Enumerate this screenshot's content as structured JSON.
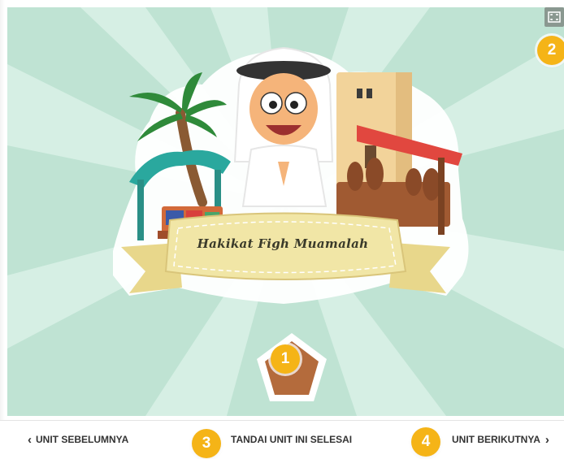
{
  "banner": {
    "title": "Hakikat Figh Muamalah"
  },
  "stage": {
    "background_color": "#bfe3d3",
    "start_button": {
      "icon": "pentagon-start-icon",
      "color": "#b46b3c"
    }
  },
  "badges": [
    "1",
    "2",
    "3",
    "4"
  ],
  "toolbar": {
    "fullscreen_icon": "fullscreen-icon"
  },
  "footer": {
    "prev_label": "UNIT SEBELUMNYA",
    "mark_complete_label": "TANDAI UNIT INI SELESAI",
    "next_label": "UNIT BERIKUTNYA",
    "prev_icon": "chevron-left-icon",
    "next_icon": "chevron-right-icon"
  },
  "colors": {
    "badge": "#f5b417",
    "accent_brown": "#b46b3c",
    "ribbon": "#f1e6a6"
  }
}
